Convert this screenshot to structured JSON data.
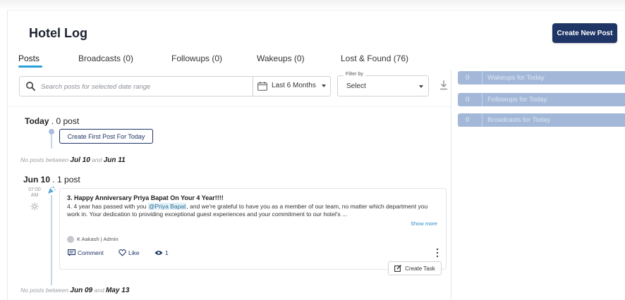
{
  "header": {
    "title": "Hotel Log",
    "create_button": "Create New Post"
  },
  "tabs": [
    {
      "label": "Posts",
      "active": true
    },
    {
      "label": "Broadcasts (0)",
      "active": false
    },
    {
      "label": "Followups (0)",
      "active": false
    },
    {
      "label": "Wakeups (0)",
      "active": false
    },
    {
      "label": "Lost & Found (76)",
      "active": false
    }
  ],
  "search": {
    "placeholder": "Search posts for selected date range",
    "date_range": "Last 6 Months"
  },
  "filter": {
    "legend": "Filter by",
    "value": "Select"
  },
  "summary": [
    {
      "count": "0",
      "label": "Wakeups for Today"
    },
    {
      "count": "0",
      "label": "Followups for Today"
    },
    {
      "count": "0",
      "label": "Broadcasts for Today"
    }
  ],
  "today": {
    "day": "Today",
    "count": ". 0 post",
    "create_first_button": "Create First Post For Today"
  },
  "range_notes": [
    {
      "prefix": "No posts between",
      "from": "Jul 10",
      "mid": "and",
      "to": "Jun 11"
    },
    {
      "prefix": "No posts between",
      "from": "Jun 09",
      "mid": "and",
      "to": "May 13"
    }
  ],
  "jun10": {
    "day": "Jun 10",
    "count": ". 1 post",
    "time": "07:00",
    "ampm": "AM",
    "post": {
      "title": "3. Happy Anniversary Priya Bapat On Your 4 Year!!!!",
      "body_before": "4. 4 year has passed with you ",
      "mention": "@Priya Bapat",
      "body_after": ", and we're grateful to have you as a member of our team, no matter which department you work in. Your dedication to providing exceptional guest experiences and your commitment to our hotel's ...",
      "show_more": "Show more",
      "author": "K Aakash | Admin",
      "comment_label": "Comment",
      "like_label": "Like",
      "views": "1"
    },
    "create_task": "Create Task"
  },
  "colors": {
    "primary": "#1f3566",
    "tab_accent": "#2aa0d6",
    "summary_bg": "#a3b8d8",
    "link": "#2a8bc4"
  }
}
